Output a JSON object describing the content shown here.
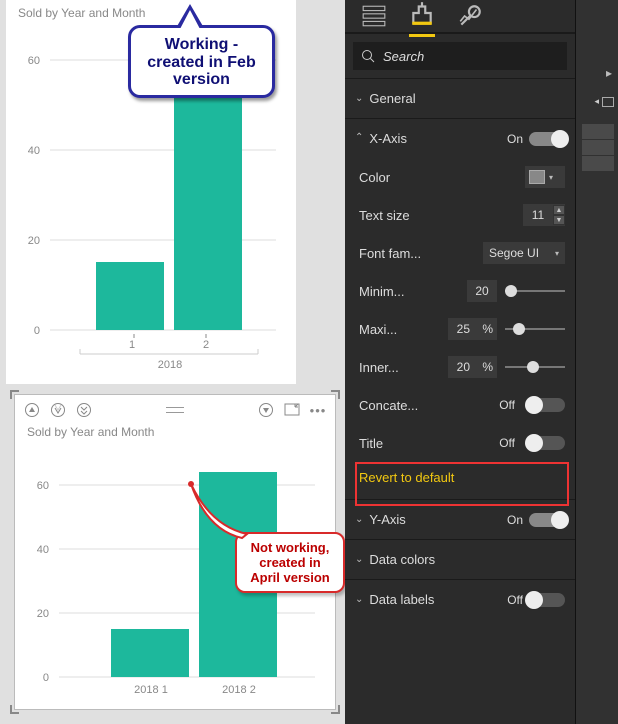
{
  "chart_data": [
    {
      "type": "bar",
      "title": "Sold by Year and Month",
      "categories": [
        "1",
        "2"
      ],
      "group_label": "2018",
      "values": [
        15,
        55
      ],
      "yticks": [
        0,
        20,
        40,
        60
      ],
      "ylim": [
        0,
        60
      ]
    },
    {
      "type": "bar",
      "title": "Sold by Year and Month",
      "categories": [
        "2018 1",
        "2018 2"
      ],
      "values": [
        15,
        64
      ],
      "yticks": [
        0,
        20,
        40,
        60
      ],
      "ylim": [
        0,
        70
      ]
    }
  ],
  "callouts": {
    "working": "Working - created in Feb version",
    "notworking": "Not working, created in April version"
  },
  "panel": {
    "search_placeholder": "Search",
    "sections": {
      "general": "General",
      "xaxis": "X-Axis",
      "yaxis": "Y-Axis",
      "datacolors": "Data colors",
      "datalabels": "Data labels"
    },
    "on": "On",
    "off": "Off",
    "xaxis": {
      "color": "Color",
      "textsize_label": "Text size",
      "textsize_value": "11",
      "fontfam_label": "Font fam...",
      "fontfam_value": "Segoe UI",
      "min_label": "Minim...",
      "min_value": "20",
      "max_label": "Maxi...",
      "max_value": "25",
      "max_unit": "%",
      "inner_label": "Inner...",
      "inner_value": "20",
      "inner_unit": "%",
      "concat_label": "Concate...",
      "title_label": "Title"
    },
    "revert": "Revert to default"
  }
}
